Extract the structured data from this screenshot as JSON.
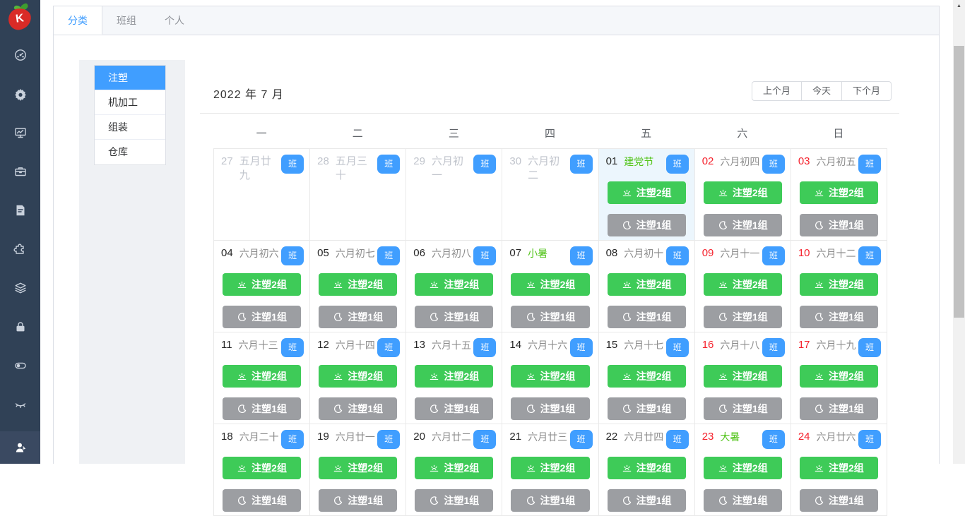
{
  "colors": {
    "accent": "#409eff",
    "green": "#3ecb58",
    "gray": "#9c9ea2",
    "red": "#f5222d",
    "holiday": "#52c41a",
    "sidebar_bg": "#304156",
    "today_bg": "#ecf6fd"
  },
  "sidebar": {
    "logo_letter": "K",
    "icons": [
      "dashboard-icon",
      "gear-icon",
      "monitor-chart-icon",
      "briefcase-icon",
      "document-icon",
      "puzzle-icon",
      "layers-icon",
      "lock-icon",
      "toggle-icon",
      "eye-closed-icon"
    ],
    "bottom_icon": "user-icon"
  },
  "tabs": [
    {
      "label": "分类",
      "active": true
    },
    {
      "label": "班组",
      "active": false
    },
    {
      "label": "个人",
      "active": false
    }
  ],
  "categories": [
    {
      "label": "注塑",
      "active": true
    },
    {
      "label": "机加工",
      "active": false
    },
    {
      "label": "组装",
      "active": false
    },
    {
      "label": "仓库",
      "active": false
    }
  ],
  "calendar": {
    "title": "2022 年 7 月",
    "nav_buttons": [
      "上个月",
      "今天",
      "下个月"
    ],
    "weekdays": [
      "一",
      "二",
      "三",
      "四",
      "五",
      "六",
      "日"
    ],
    "badge_label": "班",
    "shifts": {
      "day": "注塑2组",
      "night": "注塑1组"
    },
    "cells": [
      {
        "day": "27",
        "lunar": "五月廿九",
        "type": "prev"
      },
      {
        "day": "28",
        "lunar": "五月三十",
        "type": "prev"
      },
      {
        "day": "29",
        "lunar": "六月初一",
        "type": "prev"
      },
      {
        "day": "30",
        "lunar": "六月初二",
        "type": "prev"
      },
      {
        "day": "01",
        "lunar": "建党节",
        "type": "today",
        "lunar_green": true,
        "shifts": true
      },
      {
        "day": "02",
        "lunar": "六月初四",
        "red": true,
        "shifts": true
      },
      {
        "day": "03",
        "lunar": "六月初五",
        "red": true,
        "shifts": true
      },
      {
        "day": "04",
        "lunar": "六月初六",
        "shifts": true
      },
      {
        "day": "05",
        "lunar": "六月初七",
        "shifts": true
      },
      {
        "day": "06",
        "lunar": "六月初八",
        "shifts": true
      },
      {
        "day": "07",
        "lunar": "小暑",
        "lunar_green": true,
        "shifts": true
      },
      {
        "day": "08",
        "lunar": "六月初十",
        "shifts": true
      },
      {
        "day": "09",
        "lunar": "六月十一",
        "red": true,
        "shifts": true
      },
      {
        "day": "10",
        "lunar": "六月十二",
        "red": true,
        "shifts": true
      },
      {
        "day": "11",
        "lunar": "六月十三",
        "shifts": true
      },
      {
        "day": "12",
        "lunar": "六月十四",
        "shifts": true
      },
      {
        "day": "13",
        "lunar": "六月十五",
        "shifts": true
      },
      {
        "day": "14",
        "lunar": "六月十六",
        "shifts": true
      },
      {
        "day": "15",
        "lunar": "六月十七",
        "shifts": true
      },
      {
        "day": "16",
        "lunar": "六月十八",
        "red": true,
        "shifts": true
      },
      {
        "day": "17",
        "lunar": "六月十九",
        "red": true,
        "shifts": true
      },
      {
        "day": "18",
        "lunar": "六月二十",
        "shifts": true
      },
      {
        "day": "19",
        "lunar": "六月廿一",
        "shifts": true
      },
      {
        "day": "20",
        "lunar": "六月廿二",
        "shifts": true
      },
      {
        "day": "21",
        "lunar": "六月廿三",
        "shifts": true
      },
      {
        "day": "22",
        "lunar": "六月廿四",
        "shifts": true
      },
      {
        "day": "23",
        "lunar": "大暑",
        "red": true,
        "lunar_green": true,
        "shifts": true
      },
      {
        "day": "24",
        "lunar": "六月廿六",
        "red": true,
        "shifts": true
      }
    ]
  },
  "scrollbar": {
    "up_arrow": "▲"
  }
}
